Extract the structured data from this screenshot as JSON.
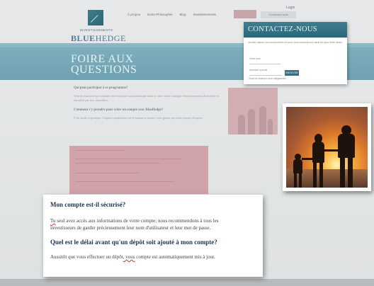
{
  "header": {
    "login": "Login",
    "logo_small": "INVESTISSEMENTS",
    "logo_brand_bold": "BLUE",
    "logo_brand_regular": "HEDGE",
    "nav": [
      "À propos",
      "Notre Philosophie",
      "Blog",
      "Investissements"
    ],
    "nav_box_label": "Contactez-nous"
  },
  "banner": {
    "title_line1": "FOIRE AUX",
    "title_line2": "QUESTIONS"
  },
  "faq_bg": {
    "q1": "Qui peut participer à ce programme?",
    "a1": "Tout investisseur qui souhaite faire fructifier son patrimoine dans le cadre d'une stratégie d'investissement diversifiée et encadrée par nos conseillers.",
    "q2": "Comment s'y prendre pour créer un compte avec BlueHedge?",
    "a2": "C'est facile et pratique. Cliquez simplement sur le bouton et laissez-vous guider par notre équipe d'experts."
  },
  "contact": {
    "title": "CONTACTEZ-NOUS",
    "intro": "Veuillez laisser vos coordonnées et nous vous contacterons dans les plus brefs délais.",
    "field_name": "Votre nom",
    "field_email": "Adresse courriel",
    "submit": "ENVOYER",
    "note": "Tous les champs sont obligatoires"
  },
  "zoom": {
    "q1": "Mon compte est-il sécurisé?",
    "a1_line1_start": "Tu",
    "a1_line1_rest": " seul avez accès aux informations de votre compte; nous recommendons à tous les",
    "a1_line2": "investisseurs de garder précieusement leur nom d'utilisateur et leur mot de passe.",
    "q2": "Quel est le délai avant qu'un dépôt soit ajouté à mon compte?",
    "a2_start": "Aussitôt que vous effectuer un dépôt",
    "a2_mid": ", vous",
    "a2_end": " compte est automatiquement mis à jour."
  },
  "colors": {
    "accent_blue": "#2b6679",
    "banner_blue": "#7eaebd",
    "redaction_pink": "#cfa3a8",
    "question_navy": "#1d3350"
  }
}
